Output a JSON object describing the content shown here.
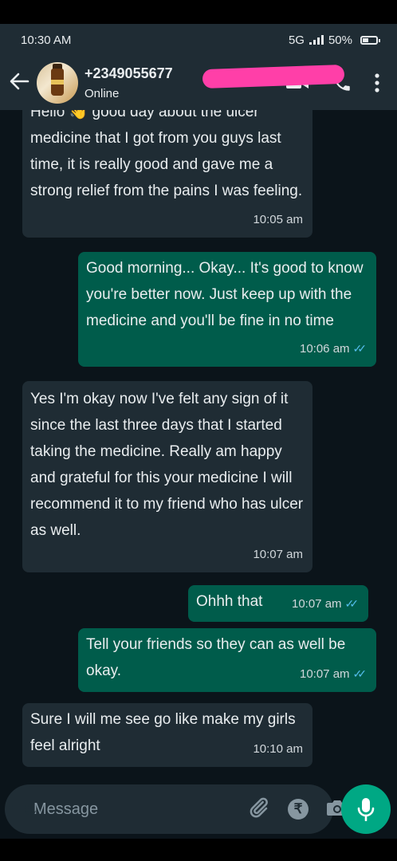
{
  "status_bar": {
    "time": "10:30 AM",
    "network": "5G",
    "battery": "50%"
  },
  "header": {
    "contact_name": "+2349055677",
    "contact_status": "Online",
    "icons": [
      "back-arrow-icon",
      "video-call-icon",
      "voice-call-icon",
      "more-options-icon"
    ]
  },
  "messages": [
    {
      "direction": "in",
      "text": "Hello 👋 good day about the ulcer medicine that I got from you guys last time, it is really good and gave me a strong relief from the pains I was feeling.",
      "time": "10:05 am"
    },
    {
      "direction": "out",
      "text": "Good morning... Okay... It's good to know you're better now. Just keep up with the medicine and you'll be fine in no time",
      "time": "10:06 am",
      "read": true
    },
    {
      "direction": "in",
      "text": "Yes I'm okay now I've felt any sign of it since the last three days that I started taking the medicine. Really am happy and grateful for this your medicine I will recommend it to my friend who has ulcer as well.",
      "time": "10:07 am"
    },
    {
      "direction": "out",
      "text": "Ohhh that",
      "time": "10:07 am",
      "read": true
    },
    {
      "direction": "out",
      "text": "Tell your friends so they can as well be okay.",
      "time": "10:07 am",
      "read": true
    },
    {
      "direction": "in",
      "text": "Sure I will me see go like make my girls feel alright",
      "time": "10:10 am"
    }
  ],
  "composer": {
    "placeholder": "Message",
    "icons": [
      "emoji-icon",
      "attach-icon",
      "rupee-payment-icon",
      "camera-icon",
      "mic-icon"
    ]
  },
  "colors": {
    "background": "#0b141a",
    "header": "#1f2c34",
    "incoming_bubble": "#1f2c34",
    "outgoing_bubble": "#005c4b",
    "accent": "#00a884",
    "read_ticks": "#53bdeb"
  }
}
